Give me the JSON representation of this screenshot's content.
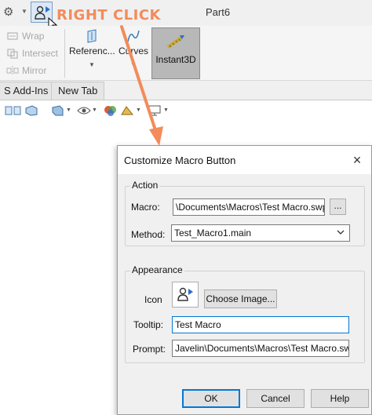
{
  "annotation": {
    "label": "RIGHT CLICK",
    "color": "#f28c5a"
  },
  "document": {
    "title": "Part6"
  },
  "ribbon": {
    "wrap": "Wrap",
    "intersect": "Intersect",
    "mirror": "Mirror",
    "reference": "Referenc...",
    "curves": "Curves",
    "instant3d": "Instant3D"
  },
  "tabs": {
    "addins": "S Add-Ins",
    "new_tab": "New Tab"
  },
  "dialog": {
    "title": "Customize Macro Button",
    "close": "×",
    "action": {
      "group_label": "Action",
      "macro_label": "Macro:",
      "macro_value": "\\Documents\\Macros\\Test Macro.swp",
      "browse_label": "...",
      "method_label": "Method:",
      "method_value": "Test_Macro1.main"
    },
    "appearance": {
      "group_label": "Appearance",
      "icon_label": "Icon",
      "choose_image": "Choose Image...",
      "tooltip_label": "Tooltip:",
      "tooltip_value": "Test Macro",
      "prompt_label": "Prompt:",
      "prompt_value": "Javelin\\Documents\\Macros\\Test Macro.swp"
    },
    "buttons": {
      "ok": "OK",
      "cancel": "Cancel",
      "help": "Help"
    }
  },
  "colors": {
    "accent": "#0078d7",
    "annotation": "#f28c5a",
    "active_tool": "#b8b8b8"
  }
}
